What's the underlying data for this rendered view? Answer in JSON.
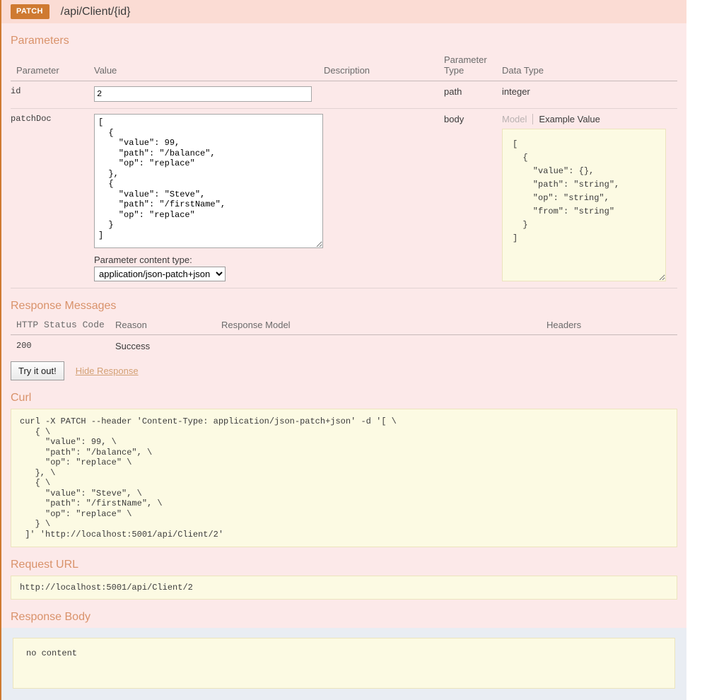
{
  "operation": {
    "method": "PATCH",
    "path": "/api/Client/{id}"
  },
  "parameters": {
    "heading": "Parameters",
    "columns": {
      "parameter": "Parameter",
      "value": "Value",
      "description": "Description",
      "parameter_type": "Parameter\nType",
      "parameter_type_line1": "Parameter",
      "parameter_type_line2": "Type",
      "data_type": "Data Type"
    },
    "rows": [
      {
        "name": "id",
        "value": "2",
        "description": "",
        "parameter_type": "path",
        "data_type": "integer"
      },
      {
        "name": "patchDoc",
        "value": "[\n  {\n    \"value\": 99,\n    \"path\": \"/balance\",\n    \"op\": \"replace\"\n  },\n  {\n    \"value\": \"Steve\",\n    \"path\": \"/firstName\",\n    \"op\": \"replace\"\n  }\n]",
        "description": "",
        "parameter_type": "body",
        "data_type": ""
      }
    ],
    "content_type": {
      "label": "Parameter content type:",
      "selected": "application/json-patch+json",
      "options": [
        "application/json-patch+json"
      ]
    },
    "model_tabs": {
      "model": "Model",
      "example_value": "Example Value"
    },
    "example_value": "[\n  {\n    \"value\": {},\n    \"path\": \"string\",\n    \"op\": \"string\",\n    \"from\": \"string\"\n  }\n]"
  },
  "response_messages": {
    "heading": "Response Messages",
    "columns": {
      "status_code": "HTTP Status Code",
      "reason": "Reason",
      "response_model": "Response Model",
      "headers": "Headers"
    },
    "rows": [
      {
        "status_code": "200",
        "reason": "Success",
        "response_model": "",
        "headers": ""
      }
    ]
  },
  "actions": {
    "submit_label": "Try it out!",
    "hide_response_label": "Hide Response"
  },
  "curl": {
    "heading": "Curl",
    "command": "curl -X PATCH --header 'Content-Type: application/json-patch+json' -d '[ \\\n   { \\\n     \"value\": 99, \\\n     \"path\": \"/balance\", \\\n     \"op\": \"replace\" \\\n   }, \\\n   { \\\n     \"value\": \"Steve\", \\\n     \"path\": \"/firstName\", \\\n     \"op\": \"replace\" \\\n   } \\\n ]' 'http://localhost:5001/api/Client/2'"
  },
  "request_url": {
    "heading": "Request URL",
    "url": "http://localhost:5001/api/Client/2"
  },
  "response_body": {
    "heading": "Response Body",
    "content": "no content"
  },
  "colors": {
    "method_badge": "#cf7a31",
    "header_bar": "#fbdcd4",
    "panel_background": "#fce9e9",
    "section_heading": "#d9926a",
    "code_background": "#fcfae3",
    "response_body_background": "#e9edf3"
  }
}
